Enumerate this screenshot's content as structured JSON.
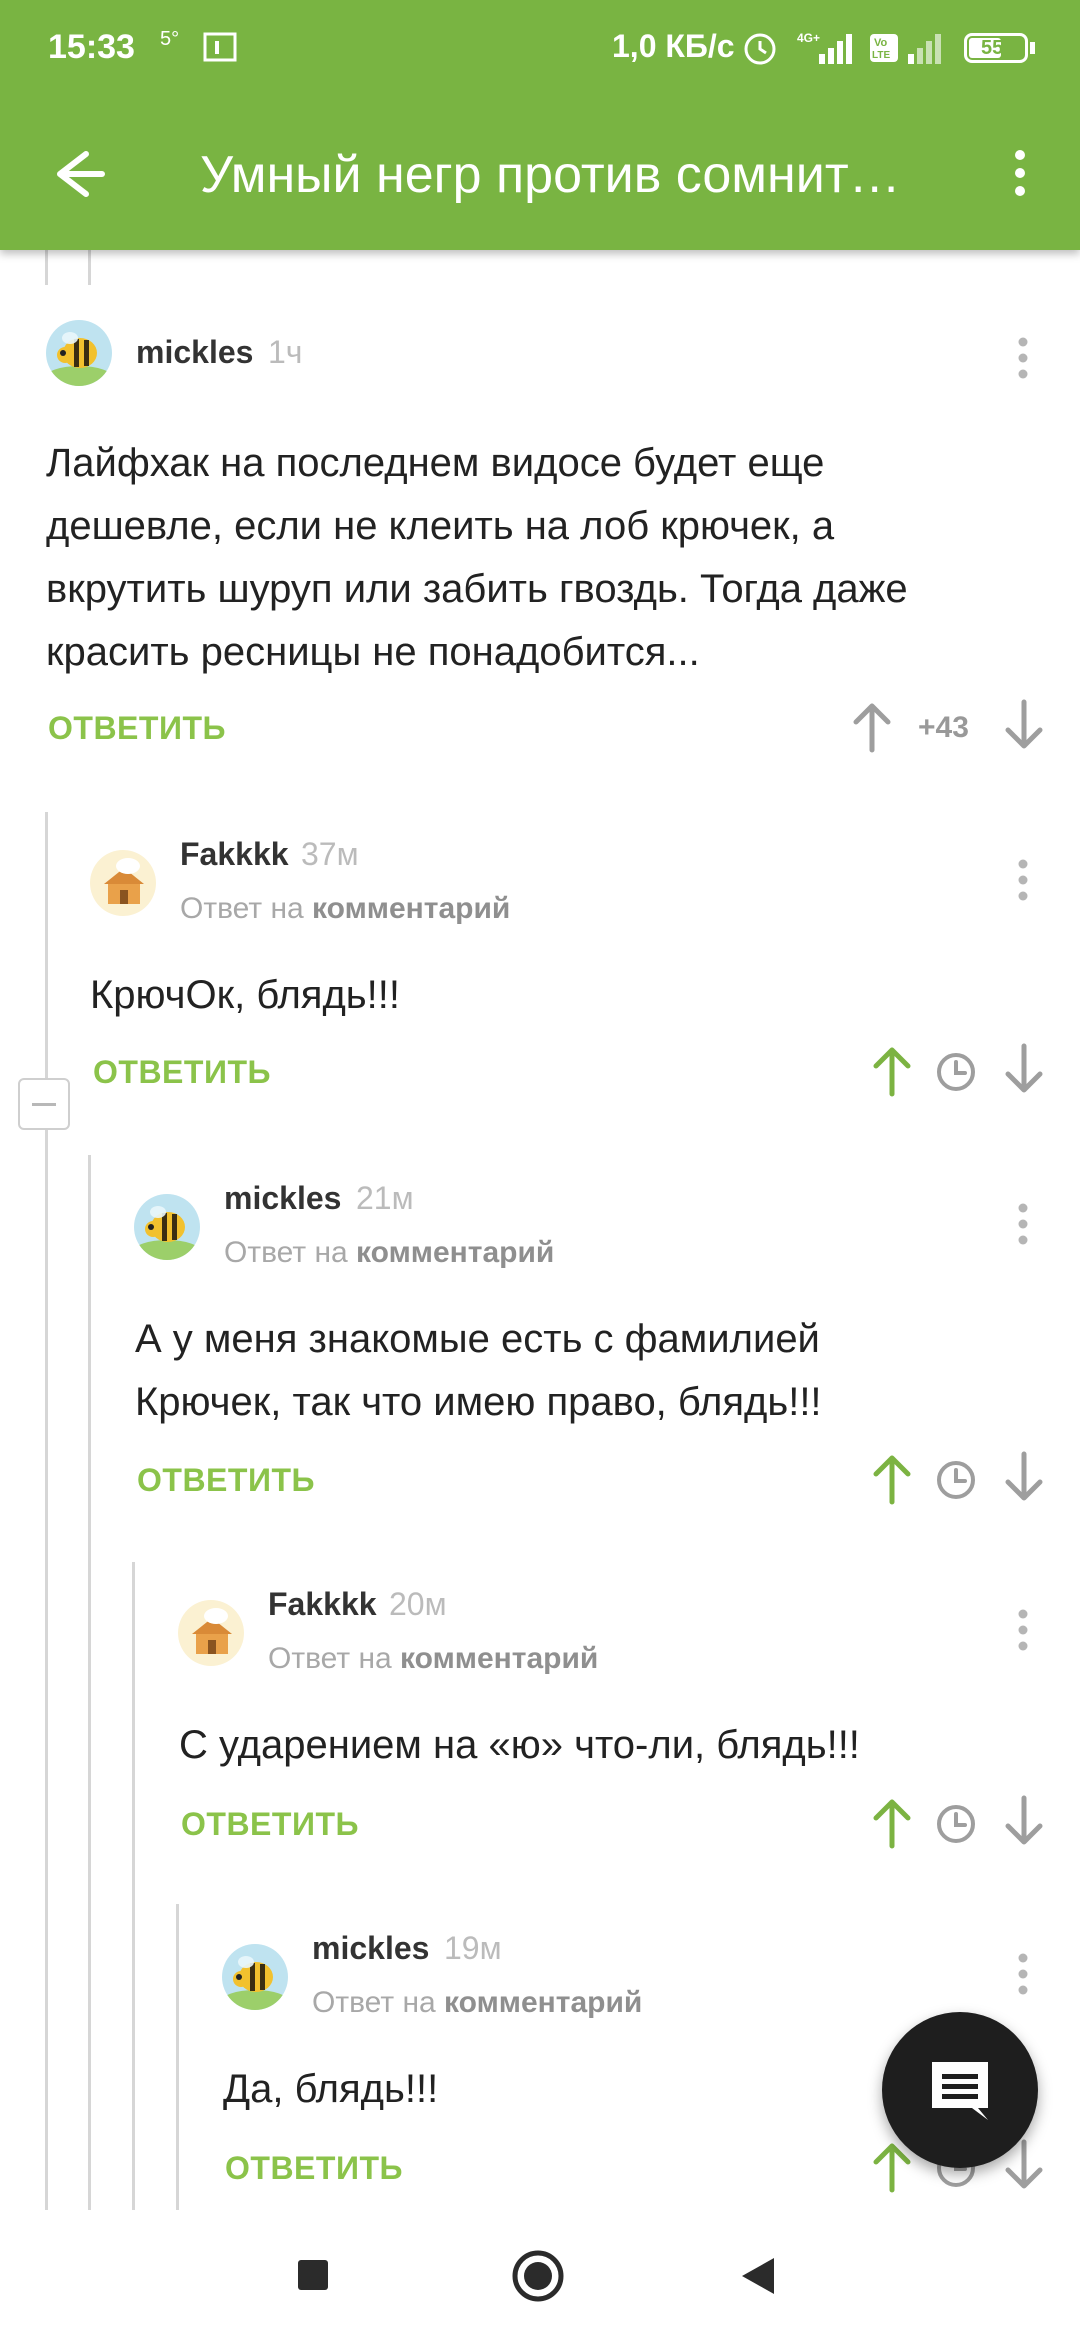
{
  "status_bar": {
    "time": "15:33",
    "temp": "5°",
    "network_speed": "1,0 КБ/с",
    "battery": "55"
  },
  "toolbar": {
    "title": "Умный негр против сомнит…"
  },
  "comments": [
    {
      "author": "mickles",
      "ago": "1ч",
      "reply_prefix": "",
      "reply_target": "",
      "lines": [
        "Лайфхак на последнем видосе будет еще",
        "дешевле, если не клеить на лоб крючек, а",
        "вкрутить шуруп или забить гвоздь. Тогда даже",
        "красить ресницы не понадобится..."
      ],
      "reply_label": "ОТВЕТИТЬ",
      "score": "+43"
    },
    {
      "author": "Fakkkk",
      "ago": "37м",
      "reply_prefix": "Ответ на ",
      "reply_target": "комментарий",
      "lines": [
        "КрючОк, блядь!!!"
      ],
      "reply_label": "ОТВЕТИТЬ"
    },
    {
      "author": "mickles",
      "ago": "21м",
      "reply_prefix": "Ответ на ",
      "reply_target": "комментарий",
      "lines": [
        "А у меня знакомые есть с фамилией",
        "Крючек, так что имею право, блядь!!!"
      ],
      "reply_label": "ОТВЕТИТЬ"
    },
    {
      "author": "Fakkkk",
      "ago": "20м",
      "reply_prefix": "Ответ на ",
      "reply_target": "комментарий",
      "lines": [
        "С ударением на «ю» что-ли, блядь!!!"
      ],
      "reply_label": "ОТВЕТИТЬ"
    },
    {
      "author": "mickles",
      "ago": "19м",
      "reply_prefix": "Ответ на ",
      "reply_target": "комментарий",
      "lines": [
        "Да, блядь!!!"
      ],
      "reply_label": "ОТВЕТИТЬ"
    }
  ],
  "colors": {
    "accent_green": "#79b442",
    "link_green": "#8bc34a",
    "fab": "#1e1e1e"
  },
  "icons": [
    "back-arrow-icon",
    "overflow-menu-icon",
    "upvote-arrow-icon",
    "downvote-arrow-icon",
    "clock-icon",
    "comment-icon",
    "nav-recents-icon",
    "nav-home-icon",
    "nav-back-icon"
  ]
}
